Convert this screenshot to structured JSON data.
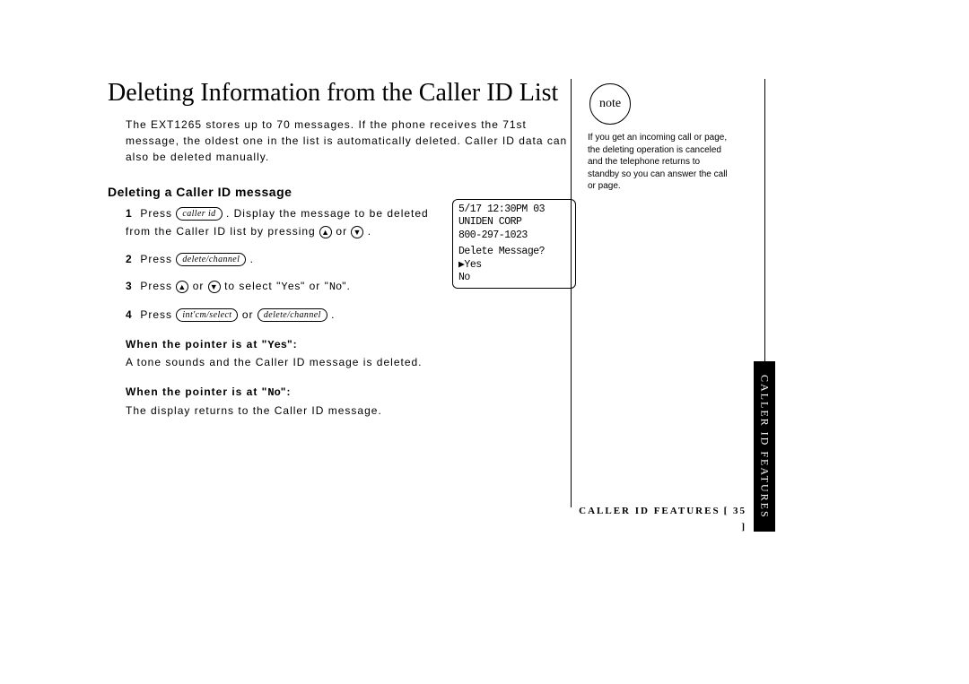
{
  "title": "Deleting Information from the Caller ID List",
  "intro": "The EXT1265 stores up to 70 messages. If the phone receives the 71st message, the oldest one in the list is automatically deleted. Caller ID data can also be deleted manually.",
  "subheading": "Deleting a Caller ID message",
  "keys": {
    "callerid": "caller id",
    "deletech": "delete/channel",
    "intcm": "int'cm/select",
    "up": "▲",
    "down": "▼"
  },
  "steps": {
    "s1a": "Press",
    "s1b": ". Display the message to be deleted from the Caller ID list by pressing",
    "s1c": "or",
    "s1d": ".",
    "s2a": "Press",
    "s2b": ".",
    "s3a": "Press",
    "s3b": " or ",
    "s3c": " to select \"",
    "s3d": "Yes",
    "s3e": "\" or \"",
    "s3f": "No",
    "s3g": "\".",
    "s4a": "Press",
    "s4b": " or ",
    "s4c": "."
  },
  "lcd": {
    "l1": "5/17 12:30PM 03",
    "l2": "UNIDEN CORP",
    "l3": "800-297-1023",
    "l4": "Delete Message?",
    "l5": "▶Yes",
    "l6": " No"
  },
  "results": {
    "yes_title_a": "When the pointer is at \"",
    "yes_mono": "Yes",
    "yes_title_b": "\":",
    "yes_body": "A tone sounds and the Caller ID message is deleted.",
    "no_title_a": "When the pointer is at \"",
    "no_mono": "No",
    "no_title_b": "\":",
    "no_body": "The display returns to the Caller ID message."
  },
  "note": {
    "label": "note",
    "body": "If you get an incoming call or page, the deleting operation is canceled and the telephone returns to standby so you can answer the call or page."
  },
  "footer": {
    "section": "CALLER ID FEATURES",
    "page": "[ 35 ]"
  },
  "tab": "CALLER ID FEATURES"
}
